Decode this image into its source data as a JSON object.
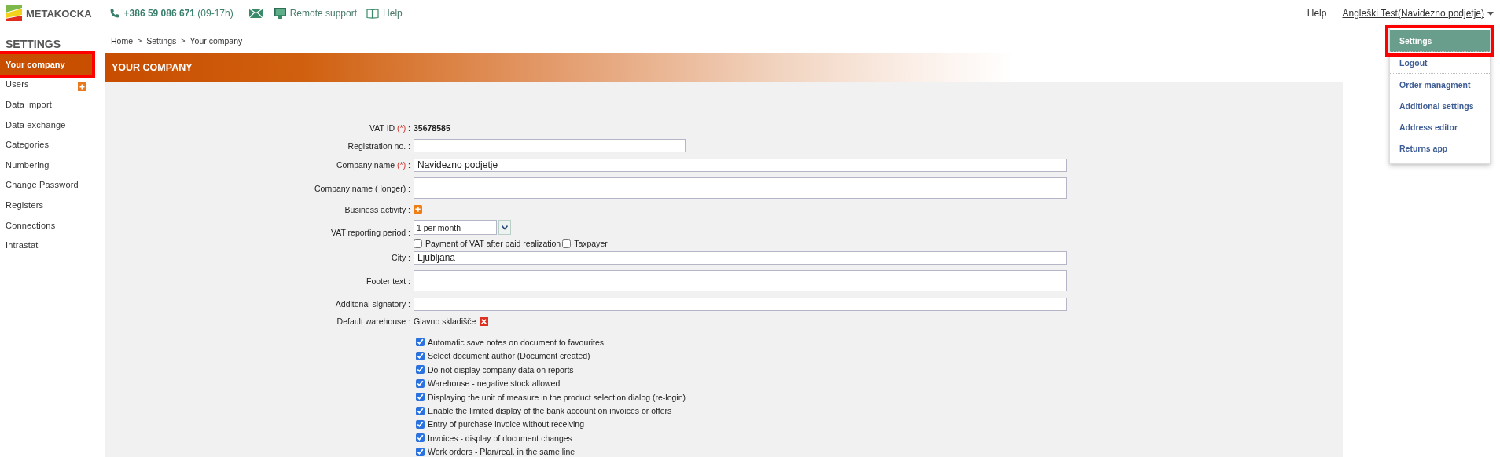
{
  "topbar": {
    "logo": "METAKOCKA",
    "phone": "+386 59 086 671",
    "hours": "(09-17h)",
    "remote_support": "Remote support",
    "help": "Help",
    "right_help": "Help",
    "user": "Angleški Test(Navidezno podjetje)"
  },
  "sidebar": {
    "title": "SETTINGS",
    "items": [
      {
        "label": "Your company",
        "selected": true,
        "highlighted": true,
        "add_button": false
      },
      {
        "label": "Users",
        "selected": false,
        "highlighted": false,
        "add_button": true
      },
      {
        "label": "Data import",
        "selected": false,
        "highlighted": false,
        "add_button": false
      },
      {
        "label": "Data exchange",
        "selected": false,
        "highlighted": false,
        "add_button": false
      },
      {
        "label": "Categories",
        "selected": false,
        "highlighted": false,
        "add_button": false
      },
      {
        "label": "Numbering",
        "selected": false,
        "highlighted": false,
        "add_button": false
      },
      {
        "label": "Change Password",
        "selected": false,
        "highlighted": false,
        "add_button": false
      },
      {
        "label": "Registers",
        "selected": false,
        "highlighted": false,
        "add_button": false
      },
      {
        "label": "Connections",
        "selected": false,
        "highlighted": false,
        "add_button": false
      },
      {
        "label": "Intrastat",
        "selected": false,
        "highlighted": false,
        "add_button": false
      }
    ]
  },
  "breadcrumb": {
    "separator": ">",
    "items": [
      "Home",
      "Settings",
      "Your company"
    ]
  },
  "header": "YOUR COMPANY",
  "form": {
    "fields": [
      {
        "kind": "static",
        "label": "VAT ID",
        "required_mark": "(*)",
        "colon": ":",
        "value": "35678585"
      },
      {
        "kind": "input",
        "label": "Registration no.",
        "colon": ":",
        "wide": false
      },
      {
        "kind": "input",
        "label": "Company name",
        "required_mark": "(*)",
        "colon": ":",
        "value": "Navidezno podjetje",
        "wide": true
      },
      {
        "kind": "textarea",
        "label": "Company name ( longer)",
        "colon": ":"
      },
      {
        "kind": "add",
        "label": "Business activity",
        "colon": ":"
      },
      {
        "kind": "select",
        "label": "VAT reporting period",
        "colon": ":",
        "value": "1 per month",
        "options": [
          {
            "label": "Payment of VAT after paid realization",
            "checked": false
          },
          {
            "label": "Taxpayer",
            "checked": false
          }
        ]
      },
      {
        "kind": "input",
        "label": "City",
        "colon": ":",
        "value": "Ljubljana",
        "wide": true
      },
      {
        "kind": "textarea",
        "label": "Footer text",
        "colon": ":"
      },
      {
        "kind": "input",
        "label": "Additonal signatory",
        "colon": ":",
        "wide": true
      },
      {
        "kind": "removable",
        "label": "Default warehouse",
        "colon": ":",
        "value": "Glavno skladišče"
      }
    ],
    "checkboxes": [
      {
        "label": "Automatic save notes on document to favourites",
        "checked": true
      },
      {
        "label": "Select document author (Document created)",
        "checked": true
      },
      {
        "label": "Do not display company data on reports",
        "checked": true
      },
      {
        "label": "Warehouse - negative stock allowed",
        "checked": true
      },
      {
        "label": "Displaying the unit of measure in the product selection dialog (re-login)",
        "checked": true
      },
      {
        "label": "Enable the limited display of the bank account on invoices or offers",
        "checked": true
      },
      {
        "label": "Entry of purchase invoice without receiving",
        "checked": true
      },
      {
        "label": "Invoices - display of document changes",
        "checked": true
      },
      {
        "label": "Work orders - Plan/real. in the same line",
        "checked": true
      }
    ]
  },
  "user_menu": {
    "items": [
      {
        "label": "Settings",
        "selected": true,
        "highlighted": true,
        "divider_after": true
      },
      {
        "label": "Logout",
        "selected": false,
        "highlighted": false,
        "divider_after": true
      },
      {
        "label": "Order managment",
        "selected": false,
        "highlighted": false,
        "divider_after": false
      },
      {
        "label": "Additional settings",
        "selected": false,
        "highlighted": false,
        "divider_after": false
      },
      {
        "label": "Address editor",
        "selected": false,
        "highlighted": false,
        "divider_after": false
      },
      {
        "label": "Returns app",
        "selected": false,
        "highlighted": false,
        "divider_after": false
      }
    ]
  }
}
